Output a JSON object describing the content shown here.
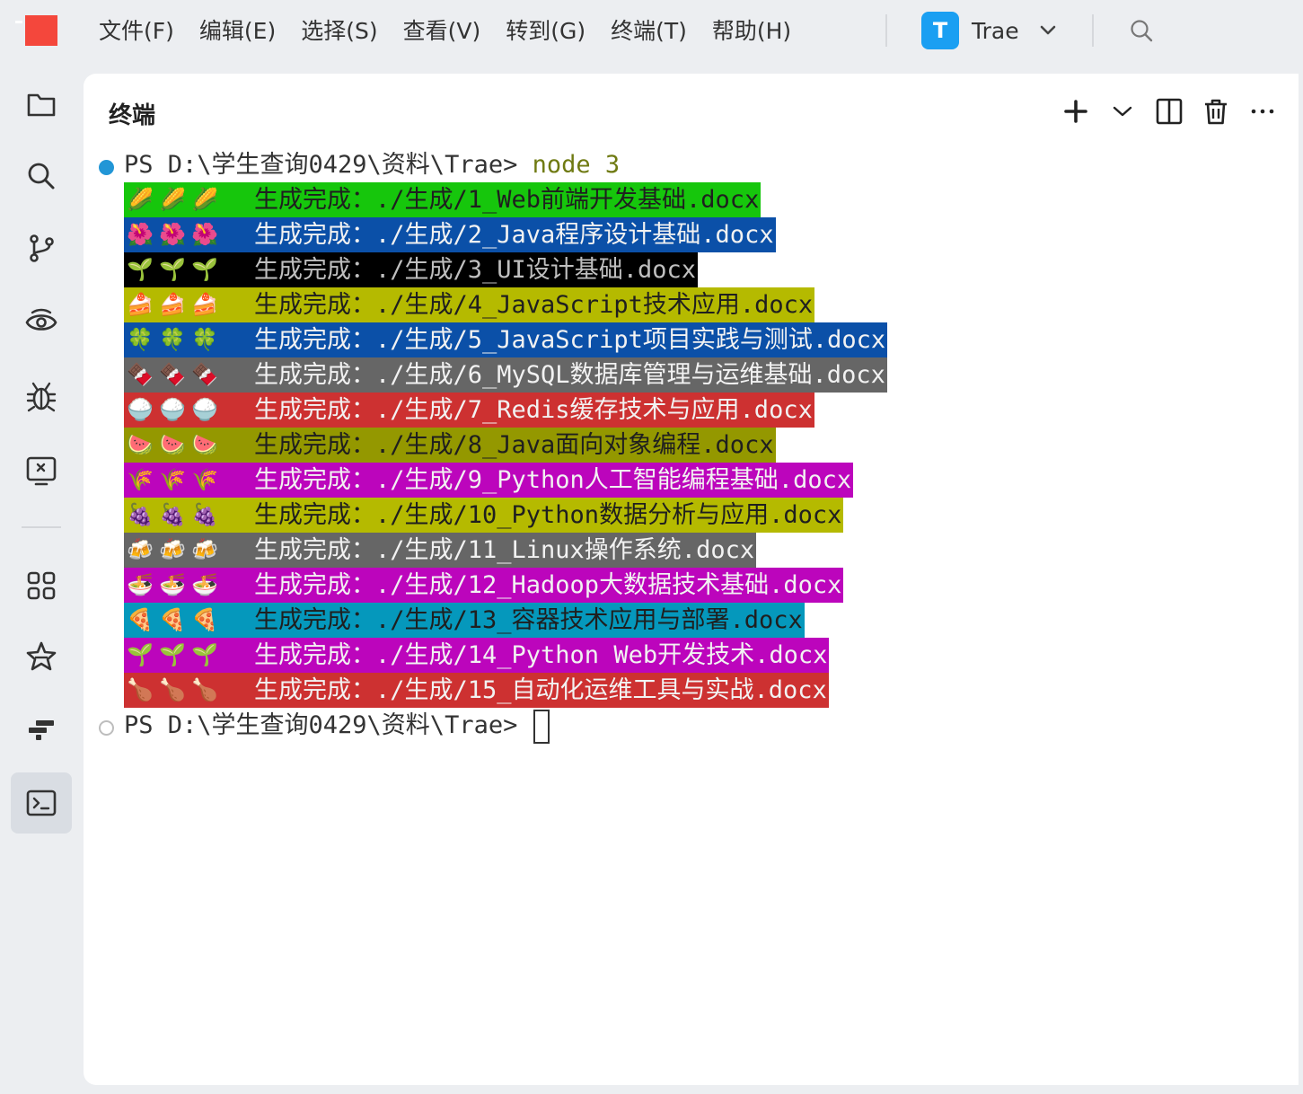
{
  "menu": [
    "文件(F)",
    "编辑(E)",
    "选择(S)",
    "查看(V)",
    "转到(G)",
    "终端(T)",
    "帮助(H)"
  ],
  "workspace": {
    "initial": "T",
    "name": "Trae"
  },
  "panel": {
    "title": "终端"
  },
  "terminal": {
    "prompt": "PS D:\\学生查询0429\\资料\\Trae>",
    "command": "node 3",
    "rows": [
      {
        "emoji": "🌽",
        "bg": "#16c60c",
        "fg": "#1f1f1f",
        "label": "生成完成：",
        "path": "./生成/1_Web前端开发基础.docx"
      },
      {
        "emoji": "🌺",
        "bg": "#0b50a8",
        "fg": "#f2f2f2",
        "label": "生成完成：",
        "path": "./生成/2_Java程序设计基础.docx"
      },
      {
        "emoji": "🌱",
        "bg": "#000000",
        "fg": "#bfbfbf",
        "label": "生成完成：",
        "path": "./生成/3_UI设计基础.docx"
      },
      {
        "emoji": "🍰",
        "bg": "#b5ba00",
        "fg": "#1f1f1f",
        "label": "生成完成：",
        "path": "./生成/4_JavaScript技术应用.docx"
      },
      {
        "emoji": "🍀",
        "bg": "#0b50a8",
        "fg": "#f2f2f2",
        "label": "生成完成：",
        "path": "./生成/5_JavaScript项目实践与测试.docx"
      },
      {
        "emoji": "🍫",
        "bg": "#666666",
        "fg": "#f2f2f2",
        "label": "生成完成：",
        "path": "./生成/6_MySQL数据库管理与运维基础.docx"
      },
      {
        "emoji": "🍚",
        "bg": "#cd3131",
        "fg": "#f2f2f2",
        "label": "生成完成：",
        "path": "./生成/7_Redis缓存技术与应用.docx"
      },
      {
        "emoji": "🍉",
        "bg": "#949800",
        "fg": "#1f1f1f",
        "label": "生成完成：",
        "path": "./生成/8_Java面向对象编程.docx"
      },
      {
        "emoji": "🌾",
        "bg": "#bc05bc",
        "fg": "#f2f2f2",
        "label": "生成完成：",
        "path": "./生成/9_Python人工智能编程基础.docx"
      },
      {
        "emoji": "🍇",
        "bg": "#b5ba00",
        "fg": "#1f1f1f",
        "label": "生成完成：",
        "path": "./生成/10_Python数据分析与应用.docx"
      },
      {
        "emoji": "🍻",
        "bg": "#666666",
        "fg": "#f2f2f2",
        "label": "生成完成：",
        "path": "./生成/11_Linux操作系统.docx"
      },
      {
        "emoji": "🍜",
        "bg": "#bc05bc",
        "fg": "#f2f2f2",
        "label": "生成完成：",
        "path": "./生成/12_Hadoop大数据技术基础.docx"
      },
      {
        "emoji": "🍕",
        "bg": "#0598bc",
        "fg": "#1f1f1f",
        "label": "生成完成：",
        "path": "./生成/13_容器技术应用与部署.docx"
      },
      {
        "emoji": "🌱",
        "bg": "#bc05bc",
        "fg": "#f2f2f2",
        "label": "生成完成：",
        "path": "./生成/14_Python Web开发技术.docx"
      },
      {
        "emoji": "🍗",
        "bg": "#cd3131",
        "fg": "#f2f2f2",
        "label": "生成完成：",
        "path": "./生成/15_自动化运维工具与实战.docx"
      }
    ]
  }
}
